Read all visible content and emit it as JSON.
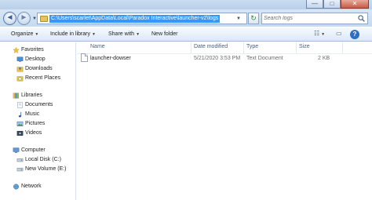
{
  "window": {
    "minimize_label": "—",
    "maximize_label": "□",
    "close_label": "✕"
  },
  "address_bar": {
    "path": "C:\\Users\\scarlet\\AppData\\Local\\Paradox Interactive\\launcher-v2\\logs",
    "back_glyph": "◄",
    "forward_glyph": "►",
    "refresh_glyph": "↻"
  },
  "search": {
    "placeholder": "Search logs"
  },
  "toolbar": {
    "organize_label": "Organize",
    "include_label": "Include in library",
    "share_label": "Share with",
    "new_folder_label": "New folder",
    "view_glyph": "☷",
    "preview_glyph": "▭",
    "help_glyph": "?"
  },
  "nav": {
    "favorites": {
      "label": "Favorites",
      "items": [
        {
          "label": "Desktop",
          "icon": "desktop-icon"
        },
        {
          "label": "Downloads",
          "icon": "downloads-icon"
        },
        {
          "label": "Recent Places",
          "icon": "recent-places-icon"
        }
      ]
    },
    "libraries": {
      "label": "Libraries",
      "items": [
        {
          "label": "Documents",
          "icon": "documents-icon"
        },
        {
          "label": "Music",
          "icon": "music-icon"
        },
        {
          "label": "Pictures",
          "icon": "pictures-icon"
        },
        {
          "label": "Videos",
          "icon": "videos-icon"
        }
      ]
    },
    "computer": {
      "label": "Computer",
      "items": [
        {
          "label": "Local Disk (C:)",
          "icon": "local-disk-icon"
        },
        {
          "label": "New Volume (E:)",
          "icon": "drive-icon"
        }
      ]
    },
    "network": {
      "label": "Network"
    }
  },
  "columns": {
    "name": "Name",
    "date_modified": "Date modified",
    "type": "Type",
    "size": "Size"
  },
  "files": [
    {
      "name": "launcher-dowser",
      "date_modified": "5/21/2020 3:53 PM",
      "type": "Text Document",
      "size": "2 KB"
    }
  ],
  "colors": {
    "selection": "#3399ff",
    "chrome": "#c9dcf0",
    "toolbar": "#dde9f6"
  }
}
